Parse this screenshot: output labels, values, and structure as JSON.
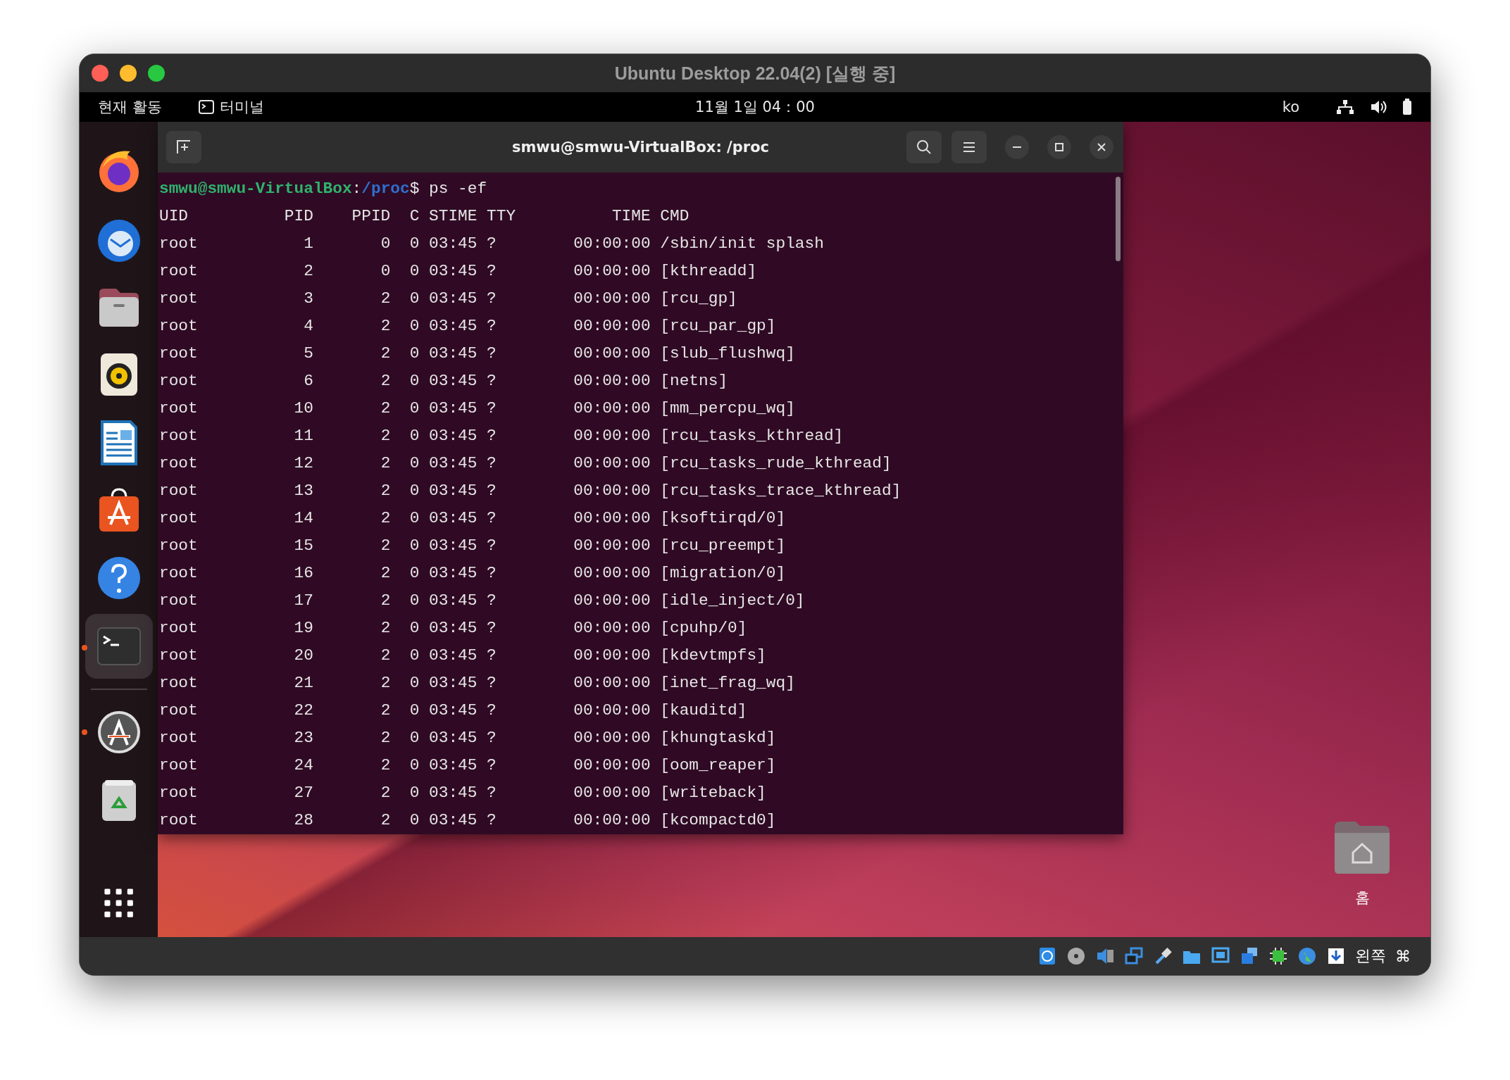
{
  "host_window": {
    "title": "Ubuntu Desktop 22.04(2) [실행 중]"
  },
  "top_bar": {
    "activities": "현재 활동",
    "app_name": "터미널",
    "clock": "11월 1일 04：00",
    "input_language": "ko"
  },
  "dock": {
    "items": [
      {
        "kind": "firefox",
        "running": false,
        "selected": false
      },
      {
        "kind": "thunderbird",
        "running": false,
        "selected": false
      },
      {
        "kind": "files",
        "running": false,
        "selected": false
      },
      {
        "kind": "rhythmbox",
        "running": false,
        "selected": false
      },
      {
        "kind": "writer",
        "running": false,
        "selected": false
      },
      {
        "kind": "appcenter",
        "running": false,
        "selected": false
      },
      {
        "kind": "help",
        "running": false,
        "selected": false
      },
      {
        "kind": "terminal",
        "running": true,
        "selected": true
      },
      {
        "kind": "separator"
      },
      {
        "kind": "updater",
        "running": true,
        "selected": false
      },
      {
        "kind": "trash",
        "running": false,
        "selected": false
      },
      {
        "kind": "grid",
        "running": false,
        "selected": false
      }
    ]
  },
  "terminal": {
    "title": "smwu@smwu-VirtualBox: /proc",
    "prompt": {
      "user_host": "smwu@smwu-VirtualBox",
      "separator": ":",
      "path": "/proc",
      "symbol": "$",
      "command": "ps -ef"
    },
    "columns": [
      "UID",
      "PID",
      "PPID",
      "C",
      "STIME",
      "TTY",
      "TIME",
      "CMD"
    ],
    "rows": [
      [
        "root",
        "1",
        "0",
        "0",
        "03:45",
        "?",
        "00:00:00",
        "/sbin/init splash"
      ],
      [
        "root",
        "2",
        "0",
        "0",
        "03:45",
        "?",
        "00:00:00",
        "[kthreadd]"
      ],
      [
        "root",
        "3",
        "2",
        "0",
        "03:45",
        "?",
        "00:00:00",
        "[rcu_gp]"
      ],
      [
        "root",
        "4",
        "2",
        "0",
        "03:45",
        "?",
        "00:00:00",
        "[rcu_par_gp]"
      ],
      [
        "root",
        "5",
        "2",
        "0",
        "03:45",
        "?",
        "00:00:00",
        "[slub_flushwq]"
      ],
      [
        "root",
        "6",
        "2",
        "0",
        "03:45",
        "?",
        "00:00:00",
        "[netns]"
      ],
      [
        "root",
        "10",
        "2",
        "0",
        "03:45",
        "?",
        "00:00:00",
        "[mm_percpu_wq]"
      ],
      [
        "root",
        "11",
        "2",
        "0",
        "03:45",
        "?",
        "00:00:00",
        "[rcu_tasks_kthread]"
      ],
      [
        "root",
        "12",
        "2",
        "0",
        "03:45",
        "?",
        "00:00:00",
        "[rcu_tasks_rude_kthread]"
      ],
      [
        "root",
        "13",
        "2",
        "0",
        "03:45",
        "?",
        "00:00:00",
        "[rcu_tasks_trace_kthread]"
      ],
      [
        "root",
        "14",
        "2",
        "0",
        "03:45",
        "?",
        "00:00:00",
        "[ksoftirqd/0]"
      ],
      [
        "root",
        "15",
        "2",
        "0",
        "03:45",
        "?",
        "00:00:00",
        "[rcu_preempt]"
      ],
      [
        "root",
        "16",
        "2",
        "0",
        "03:45",
        "?",
        "00:00:00",
        "[migration/0]"
      ],
      [
        "root",
        "17",
        "2",
        "0",
        "03:45",
        "?",
        "00:00:00",
        "[idle_inject/0]"
      ],
      [
        "root",
        "19",
        "2",
        "0",
        "03:45",
        "?",
        "00:00:00",
        "[cpuhp/0]"
      ],
      [
        "root",
        "20",
        "2",
        "0",
        "03:45",
        "?",
        "00:00:00",
        "[kdevtmpfs]"
      ],
      [
        "root",
        "21",
        "2",
        "0",
        "03:45",
        "?",
        "00:00:00",
        "[inet_frag_wq]"
      ],
      [
        "root",
        "22",
        "2",
        "0",
        "03:45",
        "?",
        "00:00:00",
        "[kauditd]"
      ],
      [
        "root",
        "23",
        "2",
        "0",
        "03:45",
        "?",
        "00:00:00",
        "[khungtaskd]"
      ],
      [
        "root",
        "24",
        "2",
        "0",
        "03:45",
        "?",
        "00:00:00",
        "[oom_reaper]"
      ],
      [
        "root",
        "27",
        "2",
        "0",
        "03:45",
        "?",
        "00:00:00",
        "[writeback]"
      ],
      [
        "root",
        "28",
        "2",
        "0",
        "03:45",
        "?",
        "00:00:00",
        "[kcompactd0]"
      ]
    ]
  },
  "desktop": {
    "home_label": "홈"
  },
  "status_bar": {
    "host_key": "왼쪽",
    "host_key_symbol": "⌘"
  }
}
